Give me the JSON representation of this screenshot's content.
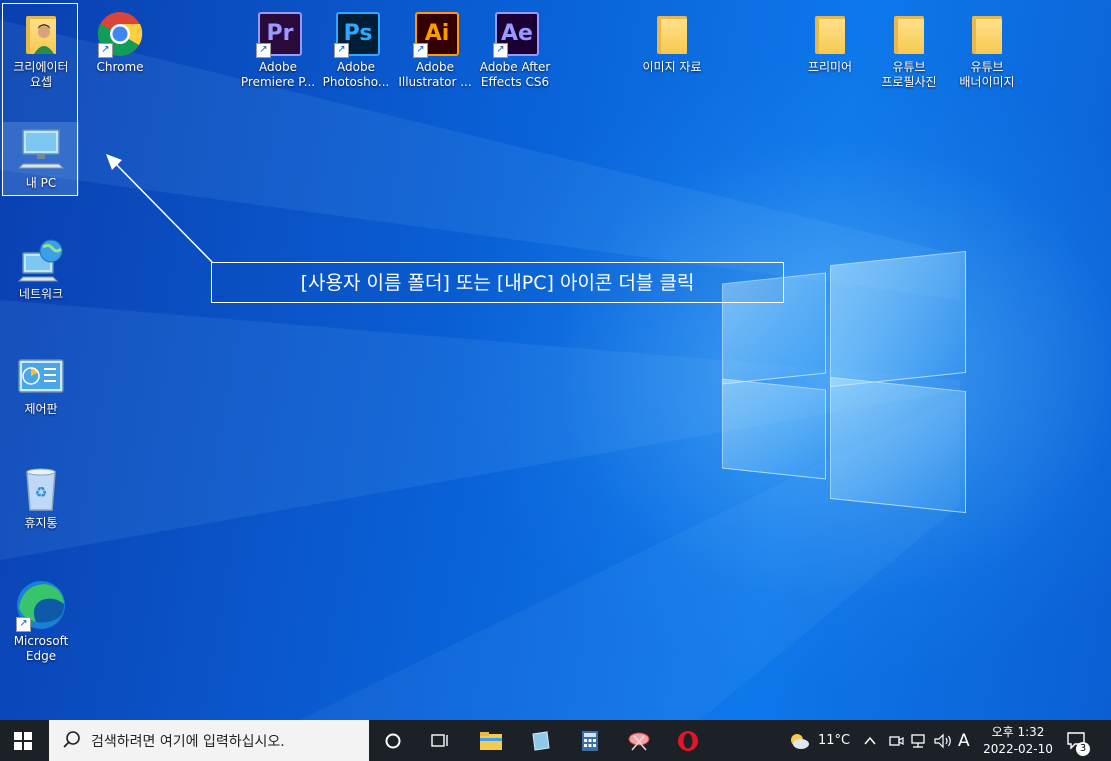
{
  "desktop": {
    "icons": [
      {
        "label": "크리에이터\n요셉",
        "kind": "user-folder"
      },
      {
        "label": "Chrome",
        "kind": "chrome"
      },
      {
        "label": "Adobe\nPremiere P...",
        "kind": "pr",
        "abbr": "Pr"
      },
      {
        "label": "Adobe\nPhotosho...",
        "kind": "ps",
        "abbr": "Ps"
      },
      {
        "label": "Adobe\nIllustrator ...",
        "kind": "ai",
        "abbr": "Ai"
      },
      {
        "label": "Adobe After\nEffects CS6",
        "kind": "ae",
        "abbr": "Ae"
      },
      {
        "label": "이미지 자료",
        "kind": "folder"
      },
      {
        "label": "프리미어",
        "kind": "folder"
      },
      {
        "label": "유튜브\n프로필사진",
        "kind": "folder"
      },
      {
        "label": "유튜브\n배너이미지",
        "kind": "folder"
      },
      {
        "label": "내 PC",
        "kind": "this-pc"
      },
      {
        "label": "네트워크",
        "kind": "network"
      },
      {
        "label": "제어판",
        "kind": "control-panel"
      },
      {
        "label": "휴지통",
        "kind": "recycle-bin"
      },
      {
        "label": "Microsoft\nEdge",
        "kind": "edge"
      }
    ]
  },
  "callout": {
    "text": "[사용자 이름 폴더] 또는 [내PC] 아이콘 더블 클릭"
  },
  "taskbar": {
    "search_placeholder": "검색하려면 여기에 입력하십시오.",
    "weather_temp": "11°C",
    "input_indicator": "A",
    "time": "오후 1:32",
    "date": "2022-02-10",
    "notification_count": "3"
  },
  "colors": {
    "premiere": "#9999ff",
    "photoshop": "#31a8ff",
    "illustrator": "#ff9a00",
    "aftereffects": "#9999ff",
    "taskbar": "#1c2128",
    "folder": "#f6c94f"
  }
}
